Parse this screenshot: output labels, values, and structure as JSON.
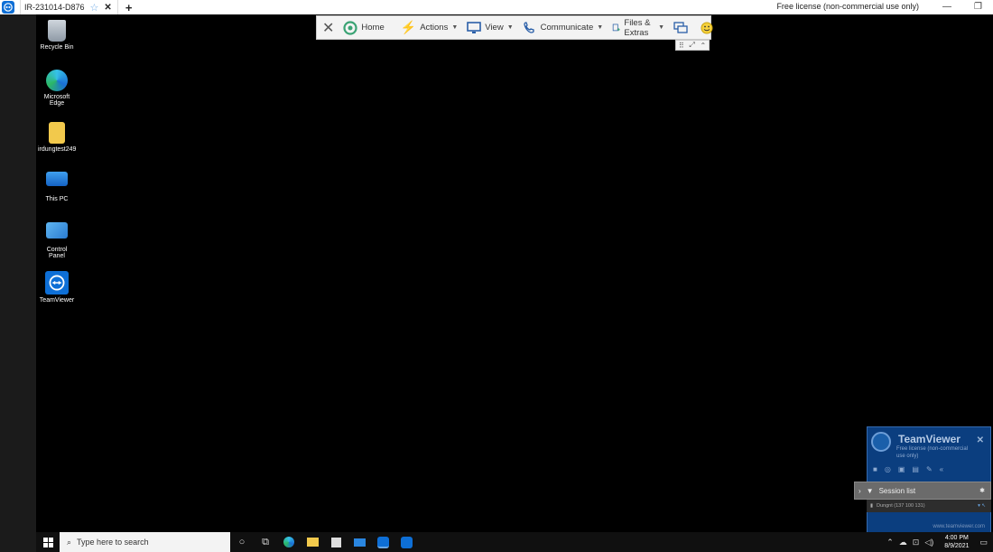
{
  "window": {
    "tab_title": "IR-231014-D876",
    "license_text": "Free license (non-commercial use only)",
    "minimize_glyph": "—",
    "restore_glyph": "❐"
  },
  "desktop": {
    "icons": [
      {
        "label": "Recycle Bin",
        "icon": "recycle-bin-icon"
      },
      {
        "label": "Microsoft Edge",
        "icon": "edge-icon"
      },
      {
        "label": "irdungtest249",
        "icon": "user-folder-icon"
      },
      {
        "label": "This PC",
        "icon": "computer-icon"
      },
      {
        "label": "Control Panel",
        "icon": "control-panel-icon"
      },
      {
        "label": "TeamViewer",
        "icon": "teamviewer-icon"
      }
    ]
  },
  "remote_toolbar": {
    "home": "Home",
    "actions": "Actions",
    "view": "View",
    "communicate": "Communicate",
    "files": "Files & Extras"
  },
  "tv_panel": {
    "brand": "TeamViewer",
    "sub": "Free license (non-commercial use only)",
    "footer": "www.teamviewer.com",
    "session_list": "Session list",
    "session_row": "Dungnt (137 100 131)"
  },
  "taskbar": {
    "search_placeholder": "Type here to search",
    "time": "4:00 PM",
    "date": "8/9/2021"
  }
}
